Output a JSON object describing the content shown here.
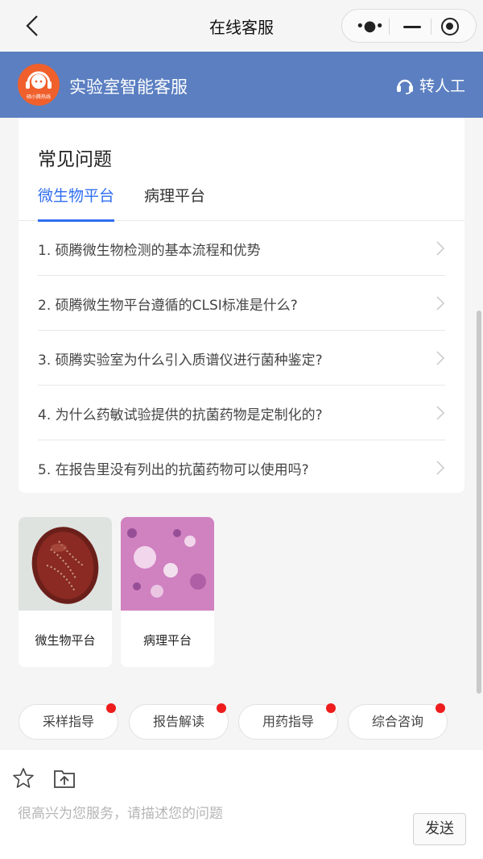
{
  "nav": {
    "title": "在线客服",
    "more_glyph": "•●•"
  },
  "header": {
    "name": "实验室智能客服",
    "logo_text": "硕小腾热线",
    "transfer_label": "转人工",
    "brand_color": "#5b7fc1",
    "logo_color": "#f0602c"
  },
  "faq": {
    "title": "常见问题",
    "tabs": [
      {
        "label": "微生物平台",
        "active": true
      },
      {
        "label": "病理平台",
        "active": false
      }
    ],
    "items": [
      {
        "text": "1.  硕腾微生物检测的基本流程和优势"
      },
      {
        "text": "2.  硕腾微生物平台遵循的CLSI标准是什么?"
      },
      {
        "text": "3.  硕腾实验室为什么引入质谱仪进行菌种鉴定?"
      },
      {
        "text": "4.  为什么药敏试验提供的抗菌药物是定制化的?"
      },
      {
        "text": "5.  在报告里没有列出的抗菌药物可以使用吗?"
      }
    ],
    "accent_color": "#2f6ef0"
  },
  "platforms": [
    {
      "label": "微生物平台",
      "icon": "petri-dish-image"
    },
    {
      "label": "病理平台",
      "icon": "histology-image"
    }
  ],
  "chips": [
    {
      "label": "采样指导",
      "badge": true
    },
    {
      "label": "报告解读",
      "badge": true
    },
    {
      "label": "用药指导",
      "badge": true
    },
    {
      "label": "综合咨询",
      "badge": true
    }
  ],
  "input": {
    "placeholder": "很高兴为您服务，请描述您的问题",
    "send_label": "发送"
  }
}
